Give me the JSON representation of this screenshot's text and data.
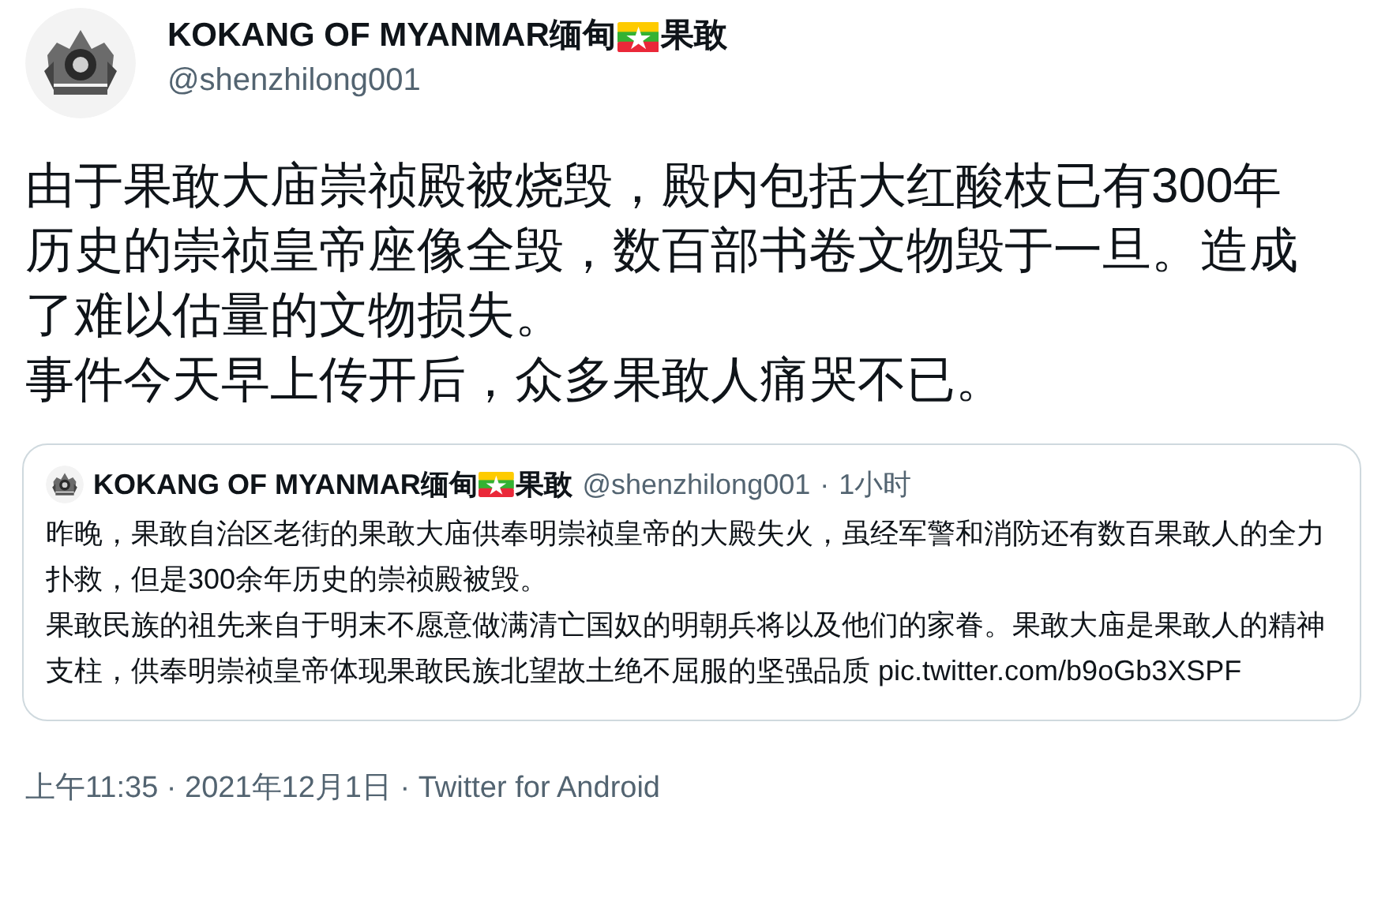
{
  "author": {
    "name_parts": [
      "KOKANG OF MYANMAR缅甸",
      "果敢"
    ],
    "handle": "@shenzhilong001"
  },
  "paragraphs": [
    "由于果敢大庙崇祯殿被烧毁，殿内包括大红酸枝已有300年历史的崇祯皇帝座像全毁，数百部书卷文物毁于一旦。造成了难以估量的文物损失。",
    "事件今天早上传开后，众多果敢人痛哭不已。"
  ],
  "quoted_tweet": {
    "name_parts": [
      "KOKANG OF MYANMAR缅甸",
      "果敢"
    ],
    "handle": "@shenzhilong001",
    "separator": "·",
    "time": "1小时",
    "paragraphs": [
      "昨晚，果敢自治区老街的果敢大庙供奉明崇祯皇帝的大殿失火，虽经军警和消防还有数百果敢人的全力扑救，但是300余年历史的崇祯殿被毁。",
      "果敢民族的祖先来自于明末不愿意做满清亡国奴的明朝兵将以及他们的家眷。果敢大庙是果敢人的精神支柱，供奉明崇祯皇帝体现果敢民族北望故土绝不屈服的坚强品质"
    ],
    "link": "pic.twitter.com/b9oGb3XSPF"
  },
  "footer": "上午11:35 · 2021年12月1日 · Twitter for Android"
}
